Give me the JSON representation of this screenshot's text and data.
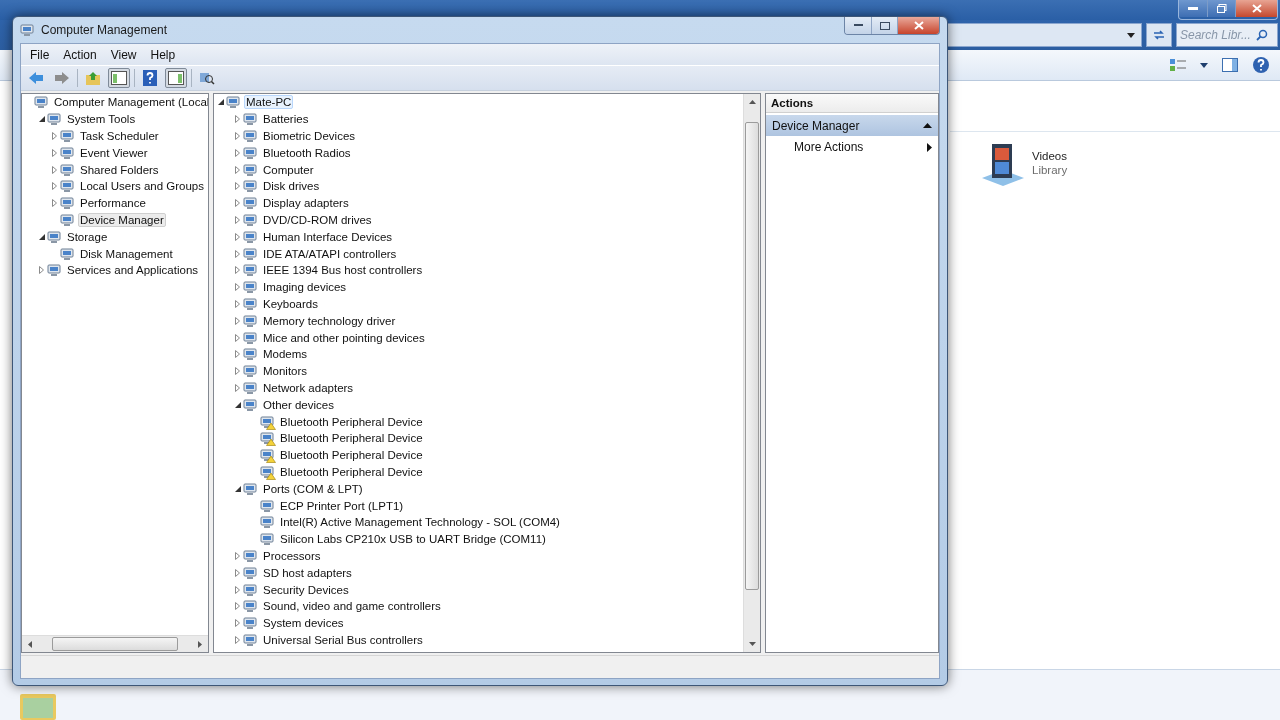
{
  "background_window": {
    "search": {
      "placeholder": "Search Libr..."
    },
    "items": [
      {
        "name": "Videos",
        "type": "Library"
      }
    ]
  },
  "window": {
    "title": "Computer Management"
  },
  "menu": [
    "File",
    "Action",
    "View",
    "Help"
  ],
  "console_tree": [
    {
      "label": "Computer Management (Local",
      "selected": false,
      "children": [
        {
          "label": "System Tools",
          "expanded": true,
          "selected": false,
          "children": [
            {
              "label": "Task Scheduler",
              "expanded": false,
              "selected": false
            },
            {
              "label": "Event Viewer",
              "expanded": false,
              "selected": false
            },
            {
              "label": "Shared Folders",
              "expanded": false,
              "selected": false
            },
            {
              "label": "Local Users and Groups",
              "expanded": false,
              "selected": false
            },
            {
              "label": "Performance",
              "expanded": false,
              "selected": false
            },
            {
              "label": "Device Manager",
              "selected": true
            }
          ]
        },
        {
          "label": "Storage",
          "expanded": true,
          "selected": false,
          "children": [
            {
              "label": "Disk Management",
              "selected": false
            }
          ]
        },
        {
          "label": "Services and Applications",
          "expanded": false,
          "selected": false
        }
      ]
    }
  ],
  "device_tree": [
    {
      "label": "Mate-PC",
      "expanded": true,
      "selected": true,
      "children": [
        {
          "label": "Batteries",
          "expanded": false
        },
        {
          "label": "Biometric Devices",
          "expanded": false
        },
        {
          "label": "Bluetooth Radios",
          "expanded": false
        },
        {
          "label": "Computer",
          "expanded": false
        },
        {
          "label": "Disk drives",
          "expanded": false
        },
        {
          "label": "Display adapters",
          "expanded": false
        },
        {
          "label": "DVD/CD-ROM drives",
          "expanded": false
        },
        {
          "label": "Human Interface Devices",
          "expanded": false
        },
        {
          "label": "IDE ATA/ATAPI controllers",
          "expanded": false
        },
        {
          "label": "IEEE 1394 Bus host controllers",
          "expanded": false
        },
        {
          "label": "Imaging devices",
          "expanded": false
        },
        {
          "label": "Keyboards",
          "expanded": false
        },
        {
          "label": "Memory technology driver",
          "expanded": false
        },
        {
          "label": "Mice and other pointing devices",
          "expanded": false
        },
        {
          "label": "Modems",
          "expanded": false
        },
        {
          "label": "Monitors",
          "expanded": false
        },
        {
          "label": "Network adapters",
          "expanded": false
        },
        {
          "label": "Other devices",
          "expanded": true,
          "children": [
            {
              "label": "Bluetooth Peripheral Device",
              "warning": true
            },
            {
              "label": "Bluetooth Peripheral Device",
              "warning": true
            },
            {
              "label": "Bluetooth Peripheral Device",
              "warning": true
            },
            {
              "label": "Bluetooth Peripheral Device",
              "warning": true
            }
          ]
        },
        {
          "label": "Ports (COM & LPT)",
          "expanded": true,
          "children": [
            {
              "label": "ECP Printer Port (LPT1)",
              "warning": false
            },
            {
              "label": "Intel(R) Active Management Technology - SOL (COM4)",
              "warning": false
            },
            {
              "label": "Silicon Labs CP210x USB to UART Bridge (COM11)",
              "warning": false
            }
          ]
        },
        {
          "label": "Processors",
          "expanded": false
        },
        {
          "label": "SD host adapters",
          "expanded": false
        },
        {
          "label": "Security Devices",
          "expanded": false
        },
        {
          "label": "Sound, video and game controllers",
          "expanded": false
        },
        {
          "label": "System devices",
          "expanded": false
        },
        {
          "label": "Universal Serial Bus controllers",
          "expanded": false
        }
      ]
    }
  ],
  "actions": {
    "title": "Actions",
    "section": {
      "label": "Device Manager",
      "expanded": true
    },
    "items": [
      "More Actions"
    ]
  }
}
